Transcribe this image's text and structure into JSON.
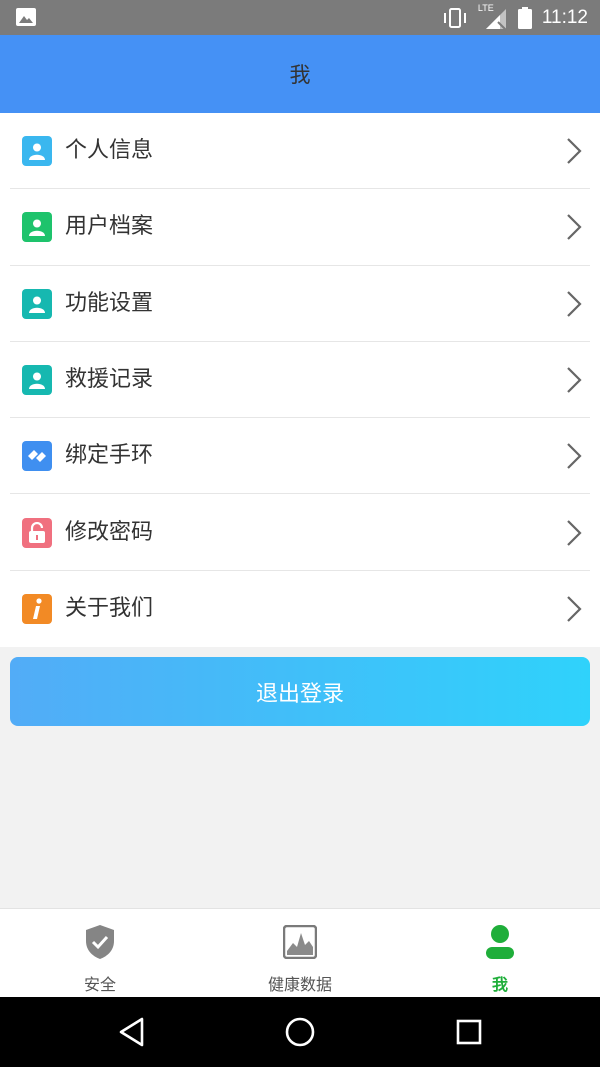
{
  "status_bar": {
    "time": "11:12",
    "network": "LTE",
    "icons": [
      "image-icon",
      "vibrate-icon",
      "signal-icon",
      "battery-icon"
    ]
  },
  "header": {
    "title": "我"
  },
  "menu": {
    "items": [
      {
        "label": "个人信息",
        "icon": "person-icon",
        "color": "#3ab7ef"
      },
      {
        "label": "用户档案",
        "icon": "person-icon",
        "color": "#1ec36c"
      },
      {
        "label": "功能设置",
        "icon": "person-icon",
        "color": "#16b8b0"
      },
      {
        "label": "救援记录",
        "icon": "person-icon",
        "color": "#16b8b0"
      },
      {
        "label": "绑定手环",
        "icon": "link-icon",
        "color": "#3f8ff0"
      },
      {
        "label": "修改密码",
        "icon": "lock-icon",
        "color": "#f0707f"
      },
      {
        "label": "关于我们",
        "icon": "info-icon",
        "color": "#f28a25"
      }
    ]
  },
  "logout": {
    "label": "退出登录",
    "gradient": [
      "#52acf7",
      "#2fd2fb"
    ]
  },
  "tabs": [
    {
      "label": "安全",
      "icon": "shield-check-icon",
      "active": false
    },
    {
      "label": "健康数据",
      "icon": "health-chart-icon",
      "active": false
    },
    {
      "label": "我",
      "icon": "person-icon",
      "active": true,
      "color": "#1fae3a"
    }
  ],
  "colors": {
    "header": "#4591f5",
    "active_tab": "#1fae3a"
  }
}
